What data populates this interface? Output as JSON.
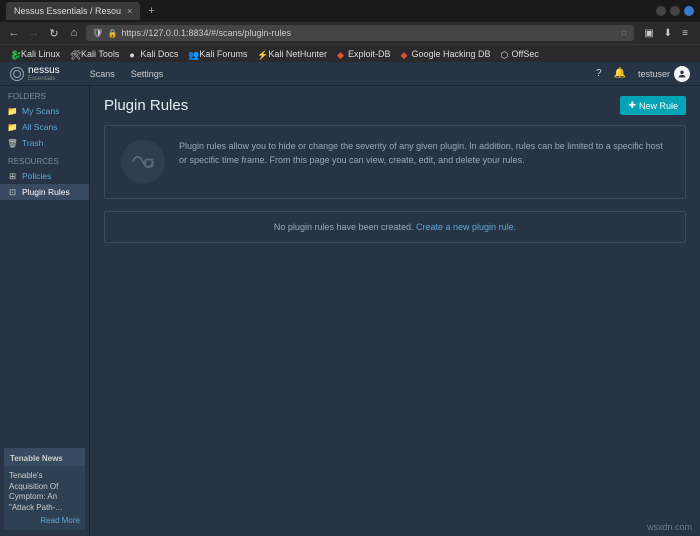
{
  "tab": {
    "title": "Nessus Essentials / Resou"
  },
  "url": {
    "text": "https://127.0.0.1:8834/#/scans/plugin-rules"
  },
  "bookmarks": [
    {
      "label": "Kali Linux"
    },
    {
      "label": "Kali Tools"
    },
    {
      "label": "Kali Docs"
    },
    {
      "label": "Kali Forums"
    },
    {
      "label": "Kali NetHunter"
    },
    {
      "label": "Exploit-DB"
    },
    {
      "label": "Google Hacking DB"
    },
    {
      "label": "OffSec"
    }
  ],
  "logo": {
    "main": "nessus",
    "sub": "Essentials"
  },
  "nav": {
    "scans": "Scans",
    "settings": "Settings"
  },
  "header": {
    "user": "testuser"
  },
  "sidebar": {
    "folders": "FOLDERS",
    "items_folders": [
      {
        "label": "My Scans"
      },
      {
        "label": "All Scans"
      },
      {
        "label": "Trash"
      }
    ],
    "resources": "RESOURCES",
    "items_res": [
      {
        "label": "Policies"
      },
      {
        "label": "Plugin Rules"
      }
    ]
  },
  "news": {
    "head": "Tenable News",
    "title": "Tenable's Acquisition Of Cymptom: An \"Attack Path-...",
    "link": "Read More"
  },
  "page": {
    "title": "Plugin Rules",
    "new_rule": "New Rule",
    "info": "Plugin rules allow you to hide or change the severity of any given plugin. In addition, rules can be limited to a specific host or specific time frame. From this page you can view, create, edit, and delete your rules.",
    "empty_prefix": "No plugin rules have been created. ",
    "empty_link": "Create a new plugin rule."
  },
  "watermark": "wsxdn.com"
}
